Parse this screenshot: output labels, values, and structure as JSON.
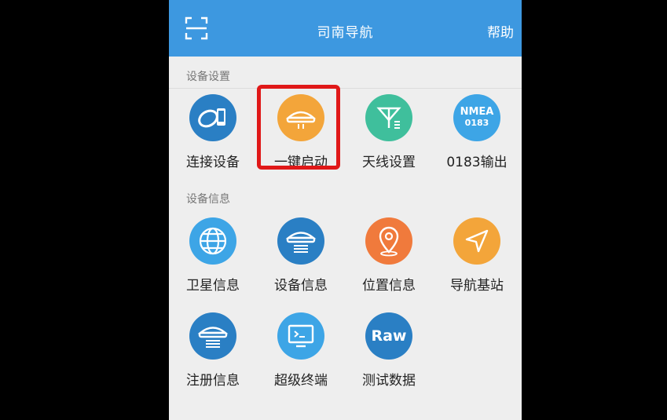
{
  "header": {
    "title": "司南导航",
    "help_label": "帮助"
  },
  "sections": {
    "device_settings": "设备设置",
    "device_info": "设备信息"
  },
  "tiles": {
    "connect": "连接设备",
    "one_key_start": "一键启动",
    "antenna": "天线设置",
    "output_0183": "0183输出",
    "satellite": "卫星信息",
    "device_info": "设备信息",
    "position": "位置信息",
    "nav_base": "导航基站",
    "register": "注册信息",
    "terminal": "超级终端",
    "test_data": "测试数据"
  },
  "icon_text": {
    "nmea_top": "NMEA",
    "nmea_bottom": "0183",
    "raw": "Raw"
  },
  "colors": {
    "header": "#3d98e0",
    "highlight": "#e01818",
    "blue_icon": "#2a7fc4",
    "orange_icon": "#f3a53a",
    "green_icon": "#3fbf9c",
    "red_icon": "#f07a3c"
  }
}
